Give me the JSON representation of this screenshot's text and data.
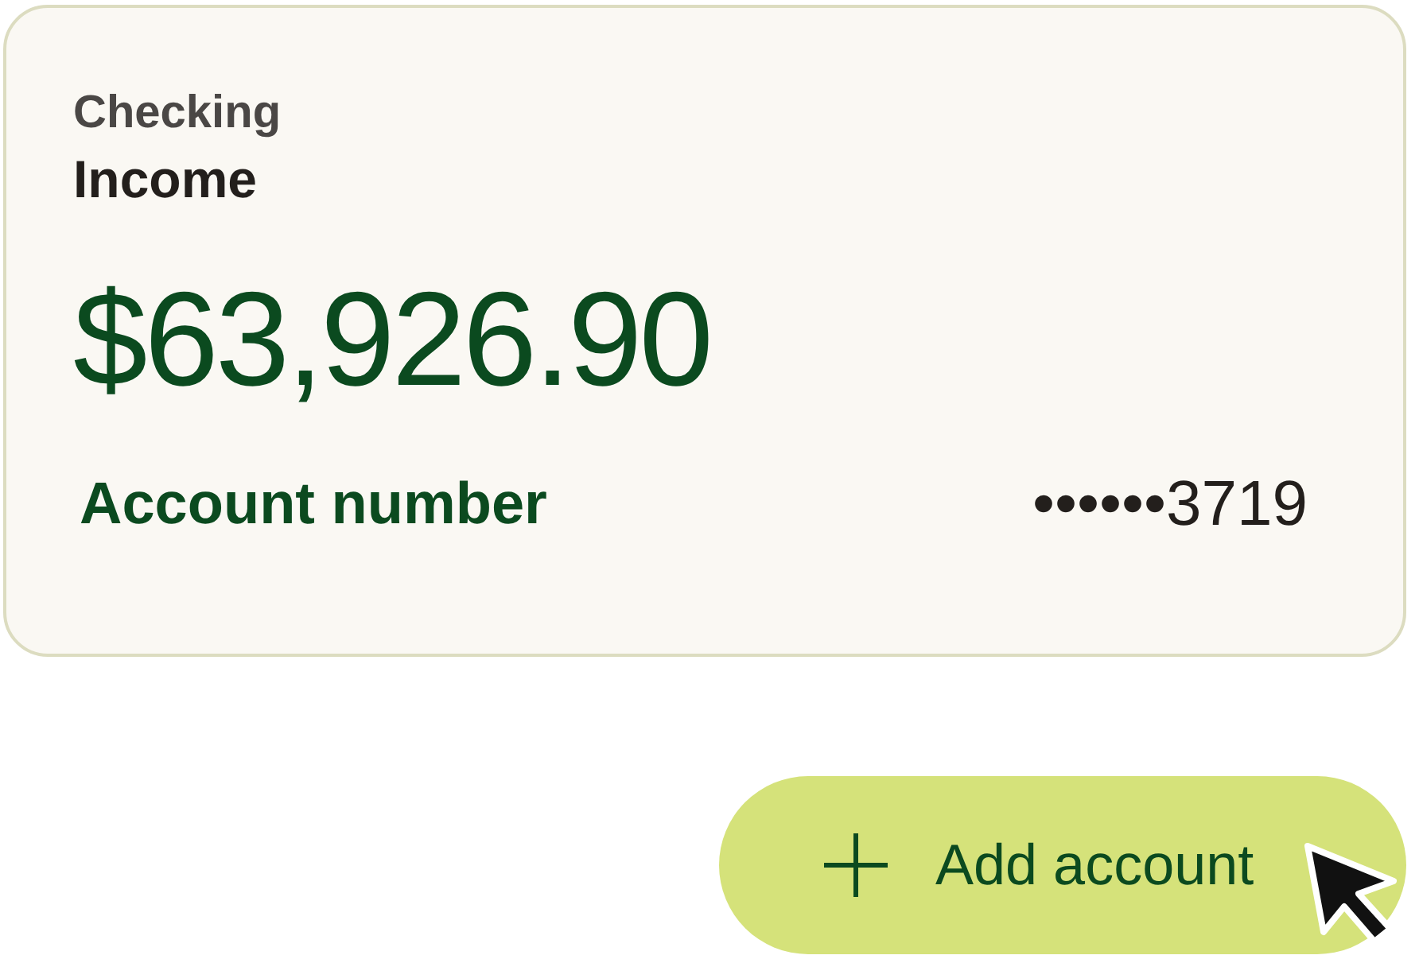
{
  "card": {
    "account_type": "Checking",
    "account_name": "Income",
    "balance": "$63,926.90",
    "account_number_label": "Account number",
    "account_number": "••••••3719"
  },
  "add_button": {
    "label": "Add account"
  }
}
